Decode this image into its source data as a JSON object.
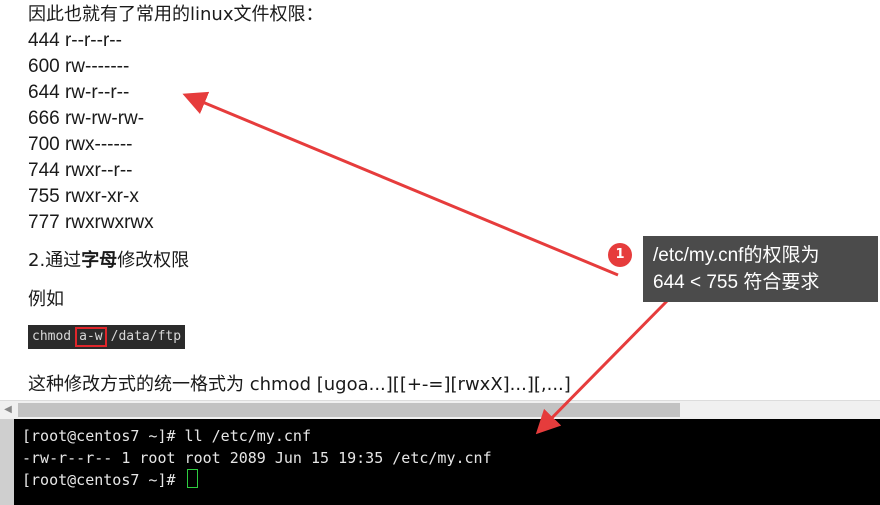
{
  "doc": {
    "intro": "因此也就有了常用的linux文件权限：",
    "permissions": [
      "444 r--r--r--",
      "600 rw-------",
      "644 rw-r--r--",
      "666 rw-rw-rw-",
      "700 rwx------",
      "744 rwxr--r--",
      "755 rwxr-xr-x",
      "777 rwxrwxrwx"
    ],
    "section_prefix": "2.通过",
    "section_bold": "字母",
    "section_suffix": "修改权限",
    "example_label": "例如",
    "code": {
      "cmd": "chmod",
      "highlight": "a-w",
      "path": "/data/ftp"
    },
    "format_line": "这种修改方式的统一格式为 chmod [ugoa...][[+-=][rwxX]...][,...]"
  },
  "terminal": {
    "line1": "[root@centos7 ~]# ll /etc/my.cnf",
    "line2": "-rw-r--r-- 1 root root 2089 Jun 15 19:35 /etc/my.cnf",
    "line3": "[root@centos7 ~]# "
  },
  "annotation": {
    "badge": "1",
    "line1": "/etc/my.cnf的权限为",
    "line2": "644 < 755 符合要求"
  },
  "colors": {
    "accent_red": "#e63c3c",
    "annotation_bg": "#4b4b4b",
    "terminal_bg": "#000000"
  }
}
